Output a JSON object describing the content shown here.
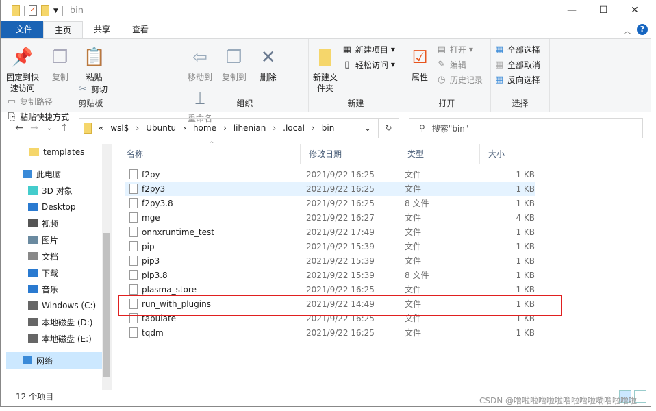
{
  "window": {
    "title": "bin",
    "controls": [
      "minimize",
      "maximize",
      "close"
    ]
  },
  "tabs": [
    {
      "label": "文件"
    },
    {
      "label": "主页"
    },
    {
      "label": "共享"
    },
    {
      "label": "查看"
    }
  ],
  "ribbon": {
    "clipboard": {
      "label": "剪贴板",
      "pin": "固定到快速访问",
      "copy": "复制",
      "paste": "粘贴",
      "copy_path": "复制路径",
      "paste_shortcut": "粘贴快捷方式",
      "cut": "剪切"
    },
    "organize": {
      "label": "组织",
      "move_to": "移动到",
      "copy_to": "复制到",
      "delete": "删除",
      "rename": "重命名"
    },
    "new": {
      "label": "新建",
      "new_folder": "新建文件夹",
      "new_item": "新建项目",
      "easy_access": "轻松访问"
    },
    "open": {
      "label": "打开",
      "properties": "属性",
      "open": "打开",
      "edit": "编辑",
      "history": "历史记录"
    },
    "select": {
      "label": "选择",
      "select_all": "全部选择",
      "select_none": "全部取消",
      "invert": "反向选择"
    }
  },
  "address": {
    "path": [
      "wsl$",
      "Ubuntu",
      "home",
      "lihenian",
      ".local",
      "bin"
    ],
    "search_placeholder": "搜索\"bin\""
  },
  "nav_pane": [
    {
      "label": "templates",
      "icon": "folder-icon"
    },
    {
      "label": "此电脑",
      "icon": "computer-icon"
    },
    {
      "label": "3D 对象",
      "icon": "3d-icon"
    },
    {
      "label": "Desktop",
      "icon": "desktop-icon"
    },
    {
      "label": "视频",
      "icon": "video-icon"
    },
    {
      "label": "图片",
      "icon": "picture-icon"
    },
    {
      "label": "文档",
      "icon": "document-icon"
    },
    {
      "label": "下载",
      "icon": "download-icon"
    },
    {
      "label": "音乐",
      "icon": "music-icon"
    },
    {
      "label": "Windows (C:)",
      "icon": "drive-icon"
    },
    {
      "label": "本地磁盘 (D:)",
      "icon": "drive-icon"
    },
    {
      "label": "本地磁盘 (E:)",
      "icon": "drive-icon"
    },
    {
      "label": "网络",
      "icon": "network-icon"
    }
  ],
  "columns": [
    "名称",
    "修改日期",
    "类型",
    "大小"
  ],
  "files": [
    {
      "name": "f2py",
      "date": "2021/9/22 16:25",
      "type": "文件",
      "size": "1 KB"
    },
    {
      "name": "f2py3",
      "date": "2021/9/22 16:25",
      "type": "文件",
      "size": "1 KB"
    },
    {
      "name": "f2py3.8",
      "date": "2021/9/22 16:25",
      "type": "8 文件",
      "size": "1 KB"
    },
    {
      "name": "mge",
      "date": "2021/9/22 16:27",
      "type": "文件",
      "size": "4 KB"
    },
    {
      "name": "onnxruntime_test",
      "date": "2021/9/22 17:49",
      "type": "文件",
      "size": "1 KB"
    },
    {
      "name": "pip",
      "date": "2021/9/22 15:39",
      "type": "文件",
      "size": "1 KB"
    },
    {
      "name": "pip3",
      "date": "2021/9/22 15:39",
      "type": "文件",
      "size": "1 KB"
    },
    {
      "name": "pip3.8",
      "date": "2021/9/22 15:39",
      "type": "8 文件",
      "size": "1 KB"
    },
    {
      "name": "plasma_store",
      "date": "2021/9/22 16:25",
      "type": "文件",
      "size": "1 KB"
    },
    {
      "name": "run_with_plugins",
      "date": "2021/9/22 14:49",
      "type": "文件",
      "size": "1 KB"
    },
    {
      "name": "tabulate",
      "date": "2021/9/22 16:25",
      "type": "文件",
      "size": "1 KB"
    },
    {
      "name": "tqdm",
      "date": "2021/9/22 16:25",
      "type": "文件",
      "size": "1 KB"
    }
  ],
  "status": "12 个项目",
  "watermark": "CSDN @噜啦啦噜啦啦噜啦噜啦嘞噜啦噜啦",
  "colors": {
    "file_tab": "#1a63b5",
    "highlight_box": "#e02020",
    "selection": "#cce8ff"
  }
}
